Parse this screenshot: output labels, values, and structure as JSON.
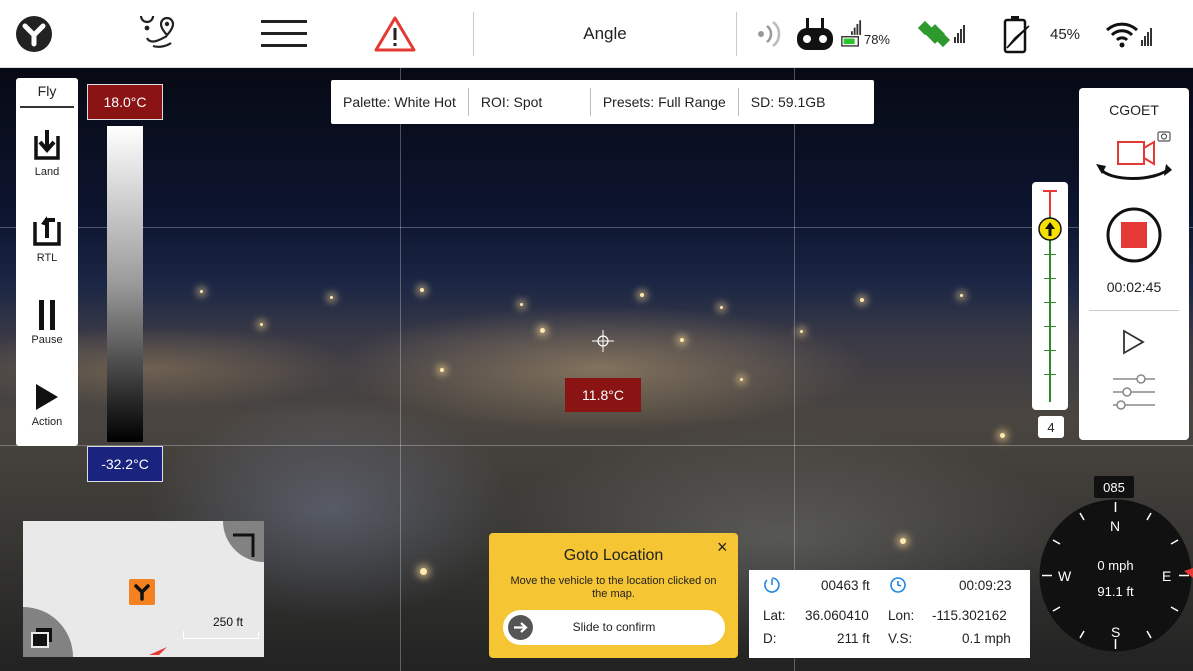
{
  "topbar": {
    "mode_title": "Angle",
    "controller_battery": "78%",
    "drone_battery": "45%"
  },
  "fly_panel": {
    "title": "Fly",
    "land_label": "Land",
    "rtl_label": "RTL",
    "pause_label": "Pause",
    "action_label": "Action"
  },
  "thermal": {
    "max_temp": "18.0°C",
    "min_temp": "-32.2°C",
    "spot_temp": "11.8°C",
    "max_color": "#8a1414",
    "min_color": "#1a237e"
  },
  "infobar": {
    "palette": "Palette:  White Hot",
    "roi": "ROI:  Spot",
    "presets": "Presets:  Full Range",
    "sd": "SD:  59.1GB"
  },
  "right_panel": {
    "title": "CGOET",
    "rec_time": "00:02:45"
  },
  "zoom": {
    "level": "4"
  },
  "minimap": {
    "scale": "250 ft"
  },
  "goto": {
    "title": "Goto Location",
    "message": "Move the vehicle to the location clicked on the map.",
    "slide_label": "Slide to confirm",
    "close": "×"
  },
  "telemetry": {
    "altitude": "00463 ft",
    "flight_time": "00:09:23",
    "lat_label": "Lat:",
    "lat": "36.060410",
    "lon_label": "Lon:",
    "lon": "-115.302162",
    "d_label": "D:",
    "distance": "211 ft",
    "vs_label": "V.S:",
    "vs": "0.1 mph"
  },
  "compass": {
    "heading": "085",
    "speed": "0 mph",
    "altitude": "91.1 ft",
    "n": "N",
    "s": "S",
    "e": "E",
    "w": "W"
  },
  "colors": {
    "accent_red": "#e53935",
    "warning_yellow": "#f6c534",
    "ok_green": "#2a8a2a"
  }
}
